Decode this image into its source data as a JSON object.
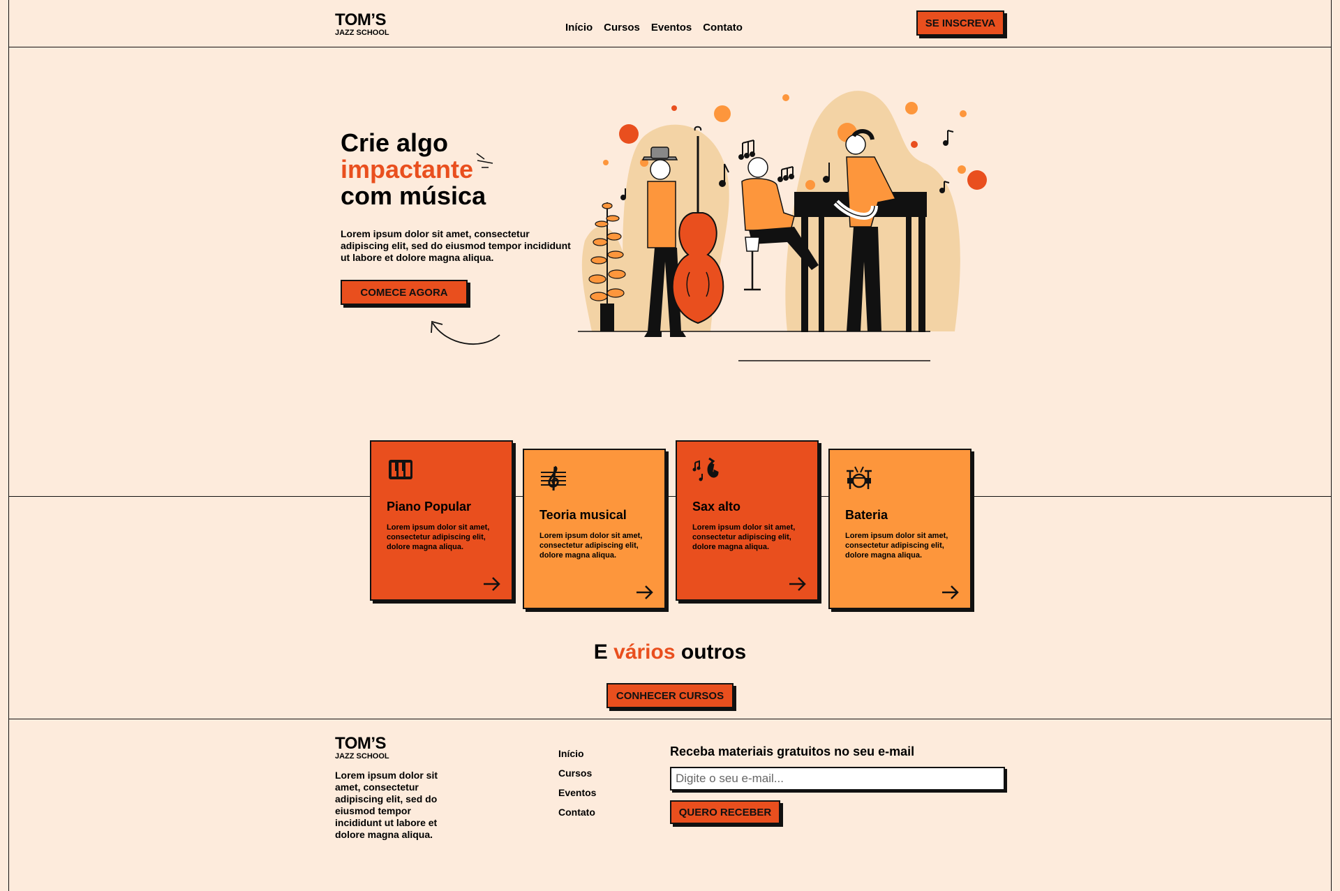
{
  "nav": {
    "logo_main": "TOM’S",
    "logo_sub": "JAZZ SCHOOL",
    "links": [
      "Início",
      "Cursos",
      "Eventos",
      "Contato"
    ],
    "cta": "SE INSCREVA"
  },
  "hero": {
    "title_line1": "Crie algo",
    "title_accent": "impactante",
    "title_line3": "com música",
    "subtitle": "Lorem ipsum dolor sit amet, consectetur adipiscing elit, sed do eiusmod tempor incididunt ut labore et dolore magna aliqua.",
    "cta": "COMECE AGORA"
  },
  "courses": [
    {
      "title": "Piano Popular",
      "text": "Lorem ipsum dolor sit amet, consectetur adipiscing elit, dolore magna aliqua.",
      "icon": "piano-icon",
      "color": "#e94f1e"
    },
    {
      "title": "Teoria musical",
      "text": "Lorem ipsum dolor sit amet, consectetur adipiscing elit, dolore magna aliqua.",
      "icon": "treble-clef-icon",
      "color": "#fd963c"
    },
    {
      "title": "Sax alto",
      "text": "Lorem ipsum dolor sit amet, consectetur adipiscing elit, dolore magna aliqua.",
      "icon": "saxophone-icon",
      "color": "#e94f1e"
    },
    {
      "title": "Bateria",
      "text": "Lorem ipsum dolor sit amet, consectetur adipiscing elit, dolore magna aliqua.",
      "icon": "drums-icon",
      "color": "#fd963c"
    }
  ],
  "others": {
    "prefix": "E ",
    "accent": "vários",
    "suffix": " outros",
    "cta": "CONHECER CURSOS"
  },
  "footer": {
    "logo_main": "TOM’S",
    "logo_sub": "JAZZ SCHOOL",
    "description": "Lorem ipsum dolor sit amet, consectetur adipiscing elit, sed do eiusmod tempor incididunt ut labore et dolore magna aliqua.",
    "links": [
      "Início",
      "Cursos",
      "Eventos",
      "Contato"
    ],
    "newsletter_title": "Receba materiais gratuitos no seu e-mail",
    "email_placeholder": "Digite o seu e-mail...",
    "submit": "QUERO RECEBER"
  },
  "colors": {
    "background": "#fdebdc",
    "primary": "#e94f1e",
    "secondary": "#fd963c",
    "ink": "#111111"
  }
}
